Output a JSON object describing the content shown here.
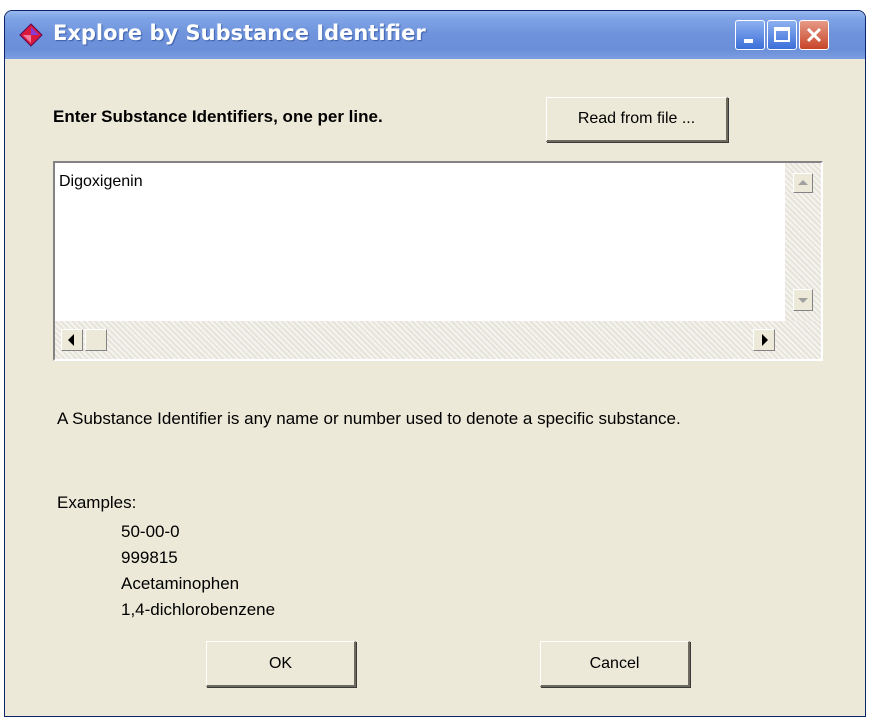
{
  "window": {
    "title": "Explore by Substance Identifier",
    "icon": "diamond-app-icon",
    "controls": {
      "minimize": "minimize-icon",
      "maximize": "maximize-icon",
      "close": "close-icon"
    }
  },
  "prompt_label": "Enter Substance Identifiers, one per line.",
  "read_from_file_label": "Read from file ...",
  "identifiers_text": "Digoxigenin",
  "description": "A Substance Identifier is any name or number used to denote a specific substance.",
  "examples_title": "Examples:",
  "examples": [
    "50-00-0",
    "999815",
    "Acetaminophen",
    "1,4-dichlorobenzene"
  ],
  "ok_label": "OK",
  "cancel_label": "Cancel",
  "colors": {
    "dialog_bg": "#ece9d8",
    "titlebar": "#6e93dc",
    "close_button": "#c7452a"
  }
}
